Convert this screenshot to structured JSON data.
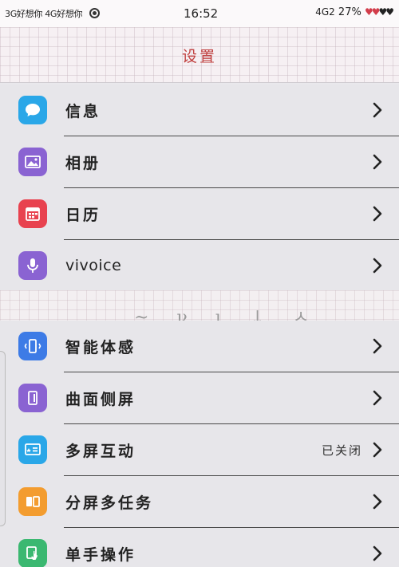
{
  "status_bar": {
    "left_text": "3G好想你 4G好想你",
    "time": "16:52",
    "network": "4G2",
    "battery": "27%",
    "hearts_full": "♥♥",
    "hearts_empty": "♥♥"
  },
  "header": {
    "title": "设置"
  },
  "group1": {
    "items": [
      {
        "label": "信息",
        "icon": "message-icon",
        "color": "#2aa7e8"
      },
      {
        "label": "相册",
        "icon": "photo-icon",
        "color": "#8a63d2"
      },
      {
        "label": "日历",
        "icon": "calendar-icon",
        "color": "#e8424f"
      },
      {
        "label": "vivoice",
        "icon": "microphone-icon",
        "color": "#8a63d2"
      }
    ]
  },
  "group2": {
    "items": [
      {
        "label": "智能体感",
        "icon": "phone-motion-icon",
        "color": "#3d7be6"
      },
      {
        "label": "曲面侧屏",
        "icon": "side-screen-icon",
        "color": "#8a63d2"
      },
      {
        "label": "多屏互动",
        "icon": "screen-cast-icon",
        "color": "#2aa7e8",
        "value": "已关闭"
      },
      {
        "label": "分屏多任务",
        "icon": "split-screen-icon",
        "color": "#f39c2f"
      },
      {
        "label": "单手操作",
        "icon": "one-hand-icon",
        "color": "#3bb871"
      }
    ]
  }
}
